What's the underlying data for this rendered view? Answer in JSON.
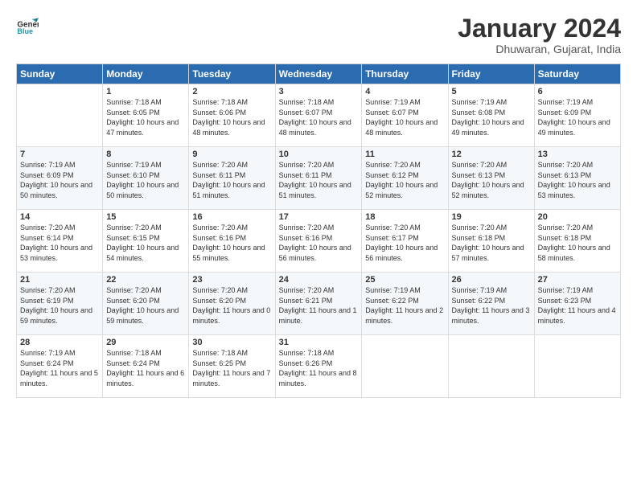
{
  "logo": {
    "text1": "General",
    "text2": "Blue"
  },
  "title": "January 2024",
  "subtitle": "Dhuwaran, Gujarat, India",
  "days_of_week": [
    "Sunday",
    "Monday",
    "Tuesday",
    "Wednesday",
    "Thursday",
    "Friday",
    "Saturday"
  ],
  "weeks": [
    [
      {
        "day": "",
        "sunrise": "",
        "sunset": "",
        "daylight": ""
      },
      {
        "day": "1",
        "sunrise": "Sunrise: 7:18 AM",
        "sunset": "Sunset: 6:05 PM",
        "daylight": "Daylight: 10 hours and 47 minutes."
      },
      {
        "day": "2",
        "sunrise": "Sunrise: 7:18 AM",
        "sunset": "Sunset: 6:06 PM",
        "daylight": "Daylight: 10 hours and 48 minutes."
      },
      {
        "day": "3",
        "sunrise": "Sunrise: 7:18 AM",
        "sunset": "Sunset: 6:07 PM",
        "daylight": "Daylight: 10 hours and 48 minutes."
      },
      {
        "day": "4",
        "sunrise": "Sunrise: 7:19 AM",
        "sunset": "Sunset: 6:07 PM",
        "daylight": "Daylight: 10 hours and 48 minutes."
      },
      {
        "day": "5",
        "sunrise": "Sunrise: 7:19 AM",
        "sunset": "Sunset: 6:08 PM",
        "daylight": "Daylight: 10 hours and 49 minutes."
      },
      {
        "day": "6",
        "sunrise": "Sunrise: 7:19 AM",
        "sunset": "Sunset: 6:09 PM",
        "daylight": "Daylight: 10 hours and 49 minutes."
      }
    ],
    [
      {
        "day": "7",
        "sunrise": "Sunrise: 7:19 AM",
        "sunset": "Sunset: 6:09 PM",
        "daylight": "Daylight: 10 hours and 50 minutes."
      },
      {
        "day": "8",
        "sunrise": "Sunrise: 7:19 AM",
        "sunset": "Sunset: 6:10 PM",
        "daylight": "Daylight: 10 hours and 50 minutes."
      },
      {
        "day": "9",
        "sunrise": "Sunrise: 7:20 AM",
        "sunset": "Sunset: 6:11 PM",
        "daylight": "Daylight: 10 hours and 51 minutes."
      },
      {
        "day": "10",
        "sunrise": "Sunrise: 7:20 AM",
        "sunset": "Sunset: 6:11 PM",
        "daylight": "Daylight: 10 hours and 51 minutes."
      },
      {
        "day": "11",
        "sunrise": "Sunrise: 7:20 AM",
        "sunset": "Sunset: 6:12 PM",
        "daylight": "Daylight: 10 hours and 52 minutes."
      },
      {
        "day": "12",
        "sunrise": "Sunrise: 7:20 AM",
        "sunset": "Sunset: 6:13 PM",
        "daylight": "Daylight: 10 hours and 52 minutes."
      },
      {
        "day": "13",
        "sunrise": "Sunrise: 7:20 AM",
        "sunset": "Sunset: 6:13 PM",
        "daylight": "Daylight: 10 hours and 53 minutes."
      }
    ],
    [
      {
        "day": "14",
        "sunrise": "Sunrise: 7:20 AM",
        "sunset": "Sunset: 6:14 PM",
        "daylight": "Daylight: 10 hours and 53 minutes."
      },
      {
        "day": "15",
        "sunrise": "Sunrise: 7:20 AM",
        "sunset": "Sunset: 6:15 PM",
        "daylight": "Daylight: 10 hours and 54 minutes."
      },
      {
        "day": "16",
        "sunrise": "Sunrise: 7:20 AM",
        "sunset": "Sunset: 6:16 PM",
        "daylight": "Daylight: 10 hours and 55 minutes."
      },
      {
        "day": "17",
        "sunrise": "Sunrise: 7:20 AM",
        "sunset": "Sunset: 6:16 PM",
        "daylight": "Daylight: 10 hours and 56 minutes."
      },
      {
        "day": "18",
        "sunrise": "Sunrise: 7:20 AM",
        "sunset": "Sunset: 6:17 PM",
        "daylight": "Daylight: 10 hours and 56 minutes."
      },
      {
        "day": "19",
        "sunrise": "Sunrise: 7:20 AM",
        "sunset": "Sunset: 6:18 PM",
        "daylight": "Daylight: 10 hours and 57 minutes."
      },
      {
        "day": "20",
        "sunrise": "Sunrise: 7:20 AM",
        "sunset": "Sunset: 6:18 PM",
        "daylight": "Daylight: 10 hours and 58 minutes."
      }
    ],
    [
      {
        "day": "21",
        "sunrise": "Sunrise: 7:20 AM",
        "sunset": "Sunset: 6:19 PM",
        "daylight": "Daylight: 10 hours and 59 minutes."
      },
      {
        "day": "22",
        "sunrise": "Sunrise: 7:20 AM",
        "sunset": "Sunset: 6:20 PM",
        "daylight": "Daylight: 10 hours and 59 minutes."
      },
      {
        "day": "23",
        "sunrise": "Sunrise: 7:20 AM",
        "sunset": "Sunset: 6:20 PM",
        "daylight": "Daylight: 11 hours and 0 minutes."
      },
      {
        "day": "24",
        "sunrise": "Sunrise: 7:20 AM",
        "sunset": "Sunset: 6:21 PM",
        "daylight": "Daylight: 11 hours and 1 minute."
      },
      {
        "day": "25",
        "sunrise": "Sunrise: 7:19 AM",
        "sunset": "Sunset: 6:22 PM",
        "daylight": "Daylight: 11 hours and 2 minutes."
      },
      {
        "day": "26",
        "sunrise": "Sunrise: 7:19 AM",
        "sunset": "Sunset: 6:22 PM",
        "daylight": "Daylight: 11 hours and 3 minutes."
      },
      {
        "day": "27",
        "sunrise": "Sunrise: 7:19 AM",
        "sunset": "Sunset: 6:23 PM",
        "daylight": "Daylight: 11 hours and 4 minutes."
      }
    ],
    [
      {
        "day": "28",
        "sunrise": "Sunrise: 7:19 AM",
        "sunset": "Sunset: 6:24 PM",
        "daylight": "Daylight: 11 hours and 5 minutes."
      },
      {
        "day": "29",
        "sunrise": "Sunrise: 7:18 AM",
        "sunset": "Sunset: 6:24 PM",
        "daylight": "Daylight: 11 hours and 6 minutes."
      },
      {
        "day": "30",
        "sunrise": "Sunrise: 7:18 AM",
        "sunset": "Sunset: 6:25 PM",
        "daylight": "Daylight: 11 hours and 7 minutes."
      },
      {
        "day": "31",
        "sunrise": "Sunrise: 7:18 AM",
        "sunset": "Sunset: 6:26 PM",
        "daylight": "Daylight: 11 hours and 8 minutes."
      },
      {
        "day": "",
        "sunrise": "",
        "sunset": "",
        "daylight": ""
      },
      {
        "day": "",
        "sunrise": "",
        "sunset": "",
        "daylight": ""
      },
      {
        "day": "",
        "sunrise": "",
        "sunset": "",
        "daylight": ""
      }
    ]
  ]
}
